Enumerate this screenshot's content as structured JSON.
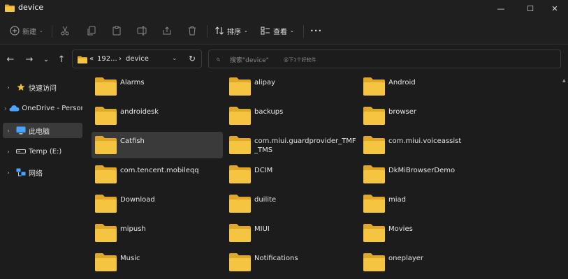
{
  "window": {
    "title": "device",
    "minimize_glyph": "—",
    "maximize_glyph": "☐",
    "close_glyph": "✕"
  },
  "toolbar": {
    "new_label": "新建",
    "sort_label": "排序",
    "view_label": "查看",
    "more_glyph": "•••",
    "chevron_glyph": "⌄"
  },
  "nav": {
    "back_glyph": "←",
    "forward_glyph": "→",
    "recent_glyph": "⌄",
    "up_glyph": "↑",
    "refresh_glyph": "↻"
  },
  "address": {
    "overflow": "«",
    "segment1": "192...",
    "separator": "›",
    "segment2": "device",
    "dropdown_glyph": "⌄"
  },
  "search": {
    "placeholder": "搜索\"device\"",
    "watermark": "@下1个好软件",
    "icon_glyph": "⌕"
  },
  "sidebar": {
    "items": [
      {
        "label": "快速访问",
        "icon": "star-icon",
        "expand_glyph": "›"
      },
      {
        "label": "OneDrive - Personal",
        "icon": "cloud-icon",
        "expand_glyph": "›"
      },
      {
        "label": "此电脑",
        "icon": "monitor-icon",
        "expand_glyph": "›",
        "selected": true
      },
      {
        "label": "Temp (E:)",
        "icon": "drive-icon",
        "expand_glyph": "›"
      },
      {
        "label": "网络",
        "icon": "network-icon",
        "expand_glyph": "›"
      }
    ]
  },
  "files": [
    {
      "name": "Alarms"
    },
    {
      "name": "alipay"
    },
    {
      "name": "Android"
    },
    {
      "name": "androidesk"
    },
    {
      "name": "backups"
    },
    {
      "name": "browser"
    },
    {
      "name": "Catfish",
      "selected": true
    },
    {
      "name": "com.miui.guardprovider_TMF_TMS"
    },
    {
      "name": "com.miui.voiceassist"
    },
    {
      "name": "com.tencent.mobileqq"
    },
    {
      "name": "DCIM"
    },
    {
      "name": "DkMiBrowserDemo"
    },
    {
      "name": "Download"
    },
    {
      "name": "duilite"
    },
    {
      "name": "miad"
    },
    {
      "name": "mipush"
    },
    {
      "name": "MIUI"
    },
    {
      "name": "Movies"
    },
    {
      "name": "Music"
    },
    {
      "name": "Notifications"
    },
    {
      "name": "oneplayer"
    }
  ],
  "colors": {
    "folder_body": "#f5c542",
    "folder_back": "#e0a82a",
    "selection": "#3a3a3a",
    "accent_blue": "#4aa3ff"
  },
  "scrollbar": {
    "up_glyph": "▲"
  }
}
